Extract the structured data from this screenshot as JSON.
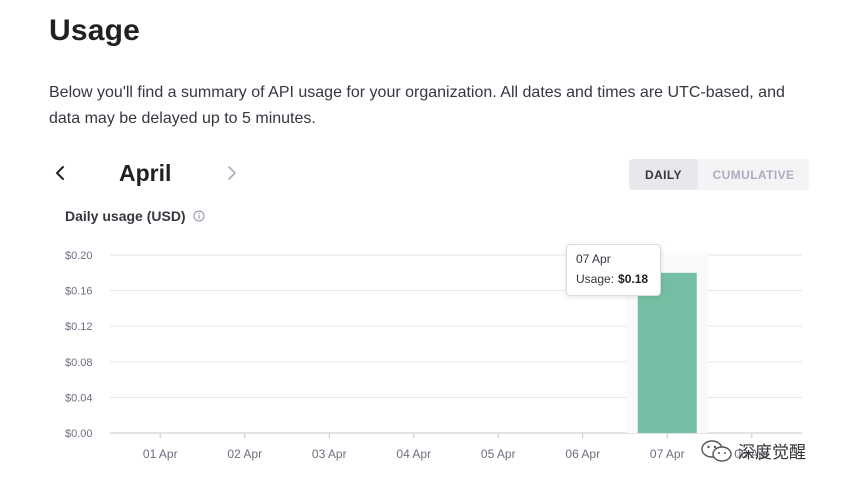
{
  "page": {
    "title": "Usage",
    "description": "Below you'll find a summary of API usage for your organization. All dates and times are UTC-based, and data may be delayed up to 5 minutes."
  },
  "month_nav": {
    "month": "April",
    "prev_icon": "chevron-left-icon",
    "next_icon": "chevron-right-icon"
  },
  "view_toggle": {
    "daily": "DAILY",
    "cumulative": "CUMULATIVE",
    "selected": "DAILY"
  },
  "chart_heading": {
    "label": "Daily usage (USD)",
    "icon": "info-icon"
  },
  "tooltip": {
    "date": "07 Apr",
    "usage_label": "Usage:",
    "usage_value": "$0.18"
  },
  "watermark": {
    "text": "深度觉醒",
    "icon": "wechat-icon"
  },
  "colors": {
    "bar": "#74bfa3",
    "grid": "#e5e5ea",
    "axis": "#c5c5d2"
  },
  "chart_data": {
    "type": "bar",
    "title": "Daily usage (USD)",
    "categories": [
      "01 Apr",
      "02 Apr",
      "03 Apr",
      "04 Apr",
      "05 Apr",
      "06 Apr",
      "07 Apr",
      "08 Apr"
    ],
    "visible_tick_labels": [
      "01 Apr",
      "02 Apr",
      "03 Apr",
      "04 Apr",
      "05 Apr",
      "06 Apr",
      "07 Apr",
      "08 Apr"
    ],
    "values": [
      0,
      0,
      0,
      0,
      0,
      0,
      0.18,
      0
    ],
    "ylim": [
      0,
      0.2
    ],
    "yticks": [
      0,
      0.04,
      0.08,
      0.12,
      0.16,
      0.2
    ],
    "ytick_labels": [
      "$0.00",
      "$0.04",
      "$0.08",
      "$0.12",
      "$0.16",
      "$0.20"
    ],
    "xlabel": "",
    "ylabel": "",
    "grid": true,
    "highlighted_category": "07 Apr"
  }
}
